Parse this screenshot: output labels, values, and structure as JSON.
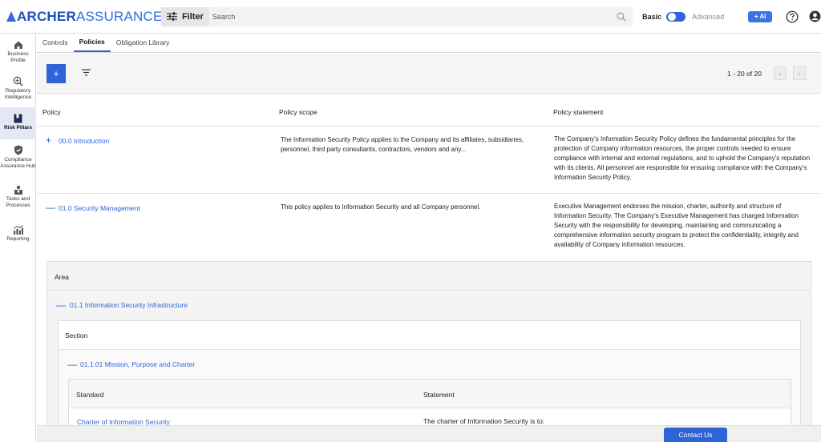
{
  "brand": {
    "part1": "ARCHER",
    "part2": "ASSURANCE AI"
  },
  "topbar": {
    "filter_label": "Filter",
    "search_placeholder": "Search",
    "toggle_basic": "Basic",
    "toggle_advanced": "Advanced",
    "mode_selected": "Basic",
    "ai_label": "+ AI"
  },
  "nav": {
    "items": [
      {
        "label": "Business Profile",
        "icon": "home-icon"
      },
      {
        "label": "Regulatory Intelligence",
        "icon": "zoom-in-icon"
      },
      {
        "label": "Risk Pillars",
        "icon": "bookmark-icon",
        "active": true
      },
      {
        "label": "Compliance Assurance Hub",
        "icon": "shield-check-icon"
      },
      {
        "label": "Tasks and Processes",
        "icon": "tasks-icon"
      },
      {
        "label": "Reporting",
        "icon": "chart-icon"
      }
    ]
  },
  "tabs": [
    {
      "label": "Controls"
    },
    {
      "label": "Policies",
      "active": true
    },
    {
      "label": "Obligation Library"
    }
  ],
  "toolbar": {
    "add_label": "+",
    "pager": "1 - 20 of 20"
  },
  "table": {
    "headers": {
      "policy": "Policy",
      "scope": "Policy scope",
      "statement": "Policy statement"
    },
    "rows": [
      {
        "toggle": "+",
        "policy": "00.0 Introduction",
        "scope": "The Information Security Policy applies to the Company and its affiliates, subsidiaries, personnel, third party consultants, contractors, vendors and any...",
        "statement": "The Company's Information Security Policy defines the fundamental principles for the protection of Company information resources, the proper controls needed to ensure compliance with internal and external regulations, and to uphold the Company's reputation with its clients. All personnel are responsible for ensuring compliance with the Company's Information Security Policy."
      },
      {
        "toggle": "—",
        "policy": "01.0 Security Management",
        "scope": "This policy applies to Information Security and all Company personnel.",
        "statement": "Executive Management endorses the mission, charter, authority and structure of Information Security. The Company's Executive Management has charged Information Security with the responsibility for developing, maintaining and communicating a comprehensive information security program to protect the confidentiality, integrity and availability of Company information resources."
      }
    ]
  },
  "area": {
    "header": "Area",
    "toggle": "—",
    "item": "01.1 Information Security Infrastructure",
    "section": {
      "header": "Section",
      "toggle": "—",
      "item": "01.1.01 Mission, Purpose and Charter",
      "standard": {
        "col_standard": "Standard",
        "col_statement": "Statement",
        "row": {
          "standard": "Charter of Information Security",
          "statement": "The charter of Information Security is to:"
        }
      }
    }
  },
  "footer": {
    "contact_label": "Contact Us"
  },
  "colors": {
    "accent": "#2f64d6",
    "brand_dark": "#1f4fb8",
    "active_nav_bg": "#e3e8f2"
  }
}
